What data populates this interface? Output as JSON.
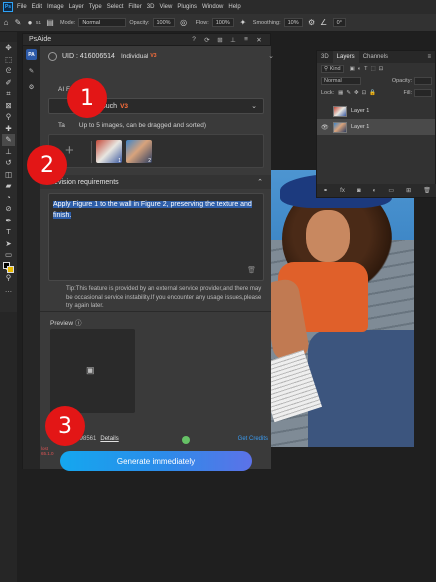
{
  "menubar": {
    "logo": "Ps",
    "items": [
      "File",
      "Edit",
      "Image",
      "Layer",
      "Type",
      "Select",
      "Filter",
      "3D",
      "View",
      "Plugins",
      "Window",
      "Help"
    ]
  },
  "options": {
    "mode_label": "Mode:",
    "mode_value": "Normal",
    "opacity_label": "Opacity:",
    "opacity_value": "100%",
    "flow_label": "Flow:",
    "flow_value": "100%",
    "smoothing_label": "Smoothing:",
    "smoothing_value": "10%",
    "angle_value": "0°",
    "brush_size": "51"
  },
  "psaide": {
    "title": "PsAide",
    "logo": "PA",
    "uid": "UID : 416006514",
    "plan": "Individual",
    "plan_badge": "V3",
    "ai_functions_label": "AI Functions",
    "function_value": "Retouch",
    "function_badge": "V3",
    "images_hint": "Up to 5 images, can be dragged and sorted)",
    "images_prefix": "Ta",
    "thumb1_num": "1",
    "thumb2_num": "2",
    "revision_label": "Revision requirements",
    "revision_text": "Apply Figure 1 to the wall in Figure 2, preserving the texture and finish.",
    "tip": "Tip:This feature is provided by an external service provider,and there may be occasional service instability.If you encounter any usage issues,please try again later.",
    "preview_label": "Preview",
    "credits_text": "s: 198561",
    "details_link": "Details",
    "get_credits": "Get Credits",
    "generate_button": "Generate immediately",
    "license_text": "lost\n65.1.0"
  },
  "layers": {
    "tabs": [
      "3D",
      "Layers",
      "Channels"
    ],
    "active_tab": "Layers",
    "kind_label": "Kind",
    "blend_mode": "Normal",
    "opacity_label": "Opacity:",
    "lock_label": "Lock:",
    "fill_label": "Fill:",
    "items": [
      "Layer 1",
      "Layer 1"
    ]
  },
  "steps": [
    "1",
    "2",
    "3"
  ],
  "colors": {
    "accent": "#2d8be9",
    "step_red": "#e31616",
    "version_orange": "#ff6f3c",
    "link_blue": "#3a9aee"
  }
}
